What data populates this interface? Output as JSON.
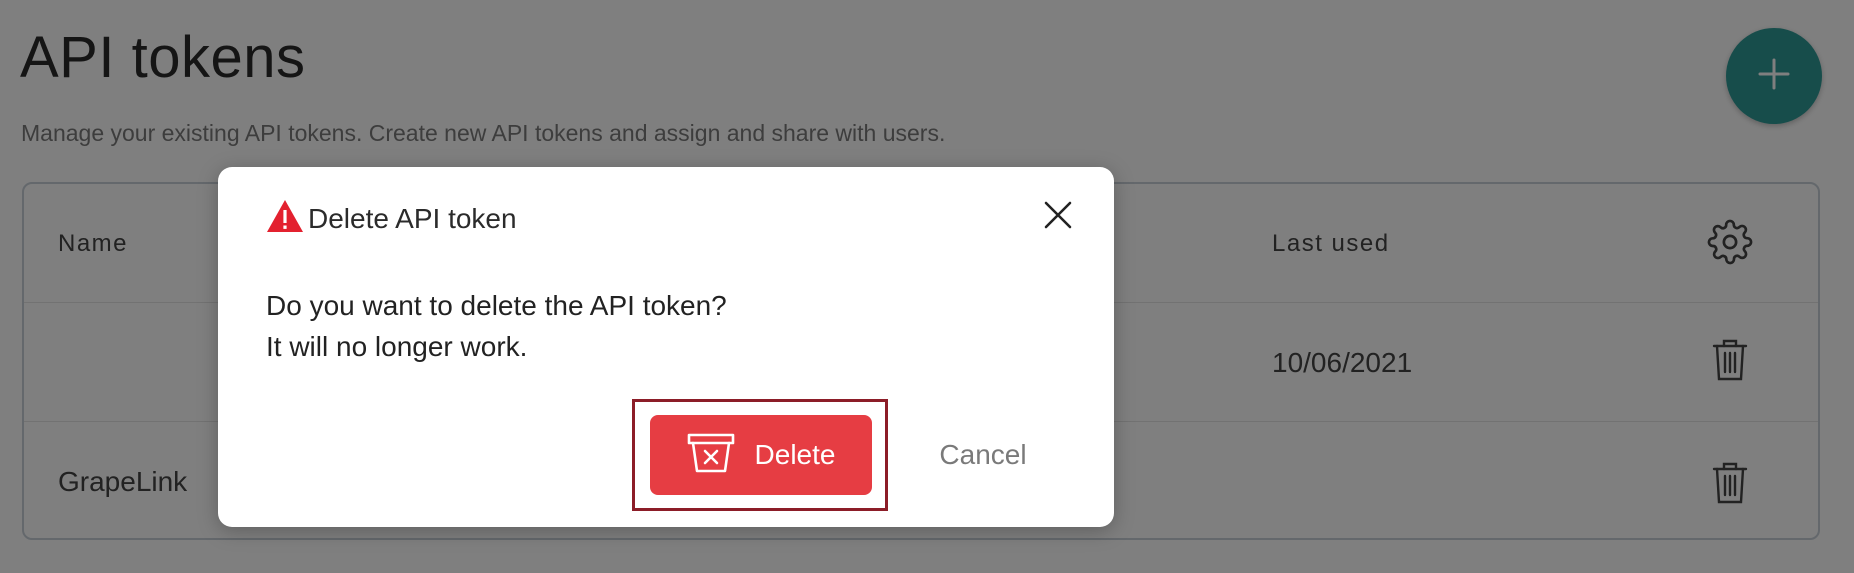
{
  "page": {
    "title": "API tokens",
    "subtitle": "Manage your existing API tokens. Create new API tokens and assign and share with users."
  },
  "table": {
    "headers": {
      "name": "Name",
      "last_used": "Last used"
    },
    "rows": [
      {
        "name": "",
        "last_used": "10/06/2021"
      },
      {
        "name": "GrapeLink",
        "last_used": ""
      }
    ]
  },
  "dialog": {
    "title": "Delete API token",
    "message_line1": "Do you want to delete the API token?",
    "message_line2": "It will no longer work.",
    "delete_label": "Delete",
    "cancel_label": "Cancel"
  },
  "colors": {
    "accent_teal": "#2f9a97",
    "danger_red": "#e63d43",
    "highlight_border": "#8c1d28",
    "overlay": "rgba(0,0,0,0.5)"
  },
  "icons": [
    "plus-icon",
    "settings-gear-icon",
    "trash-icon",
    "warning-icon",
    "close-icon",
    "bucket-delete-icon"
  ]
}
